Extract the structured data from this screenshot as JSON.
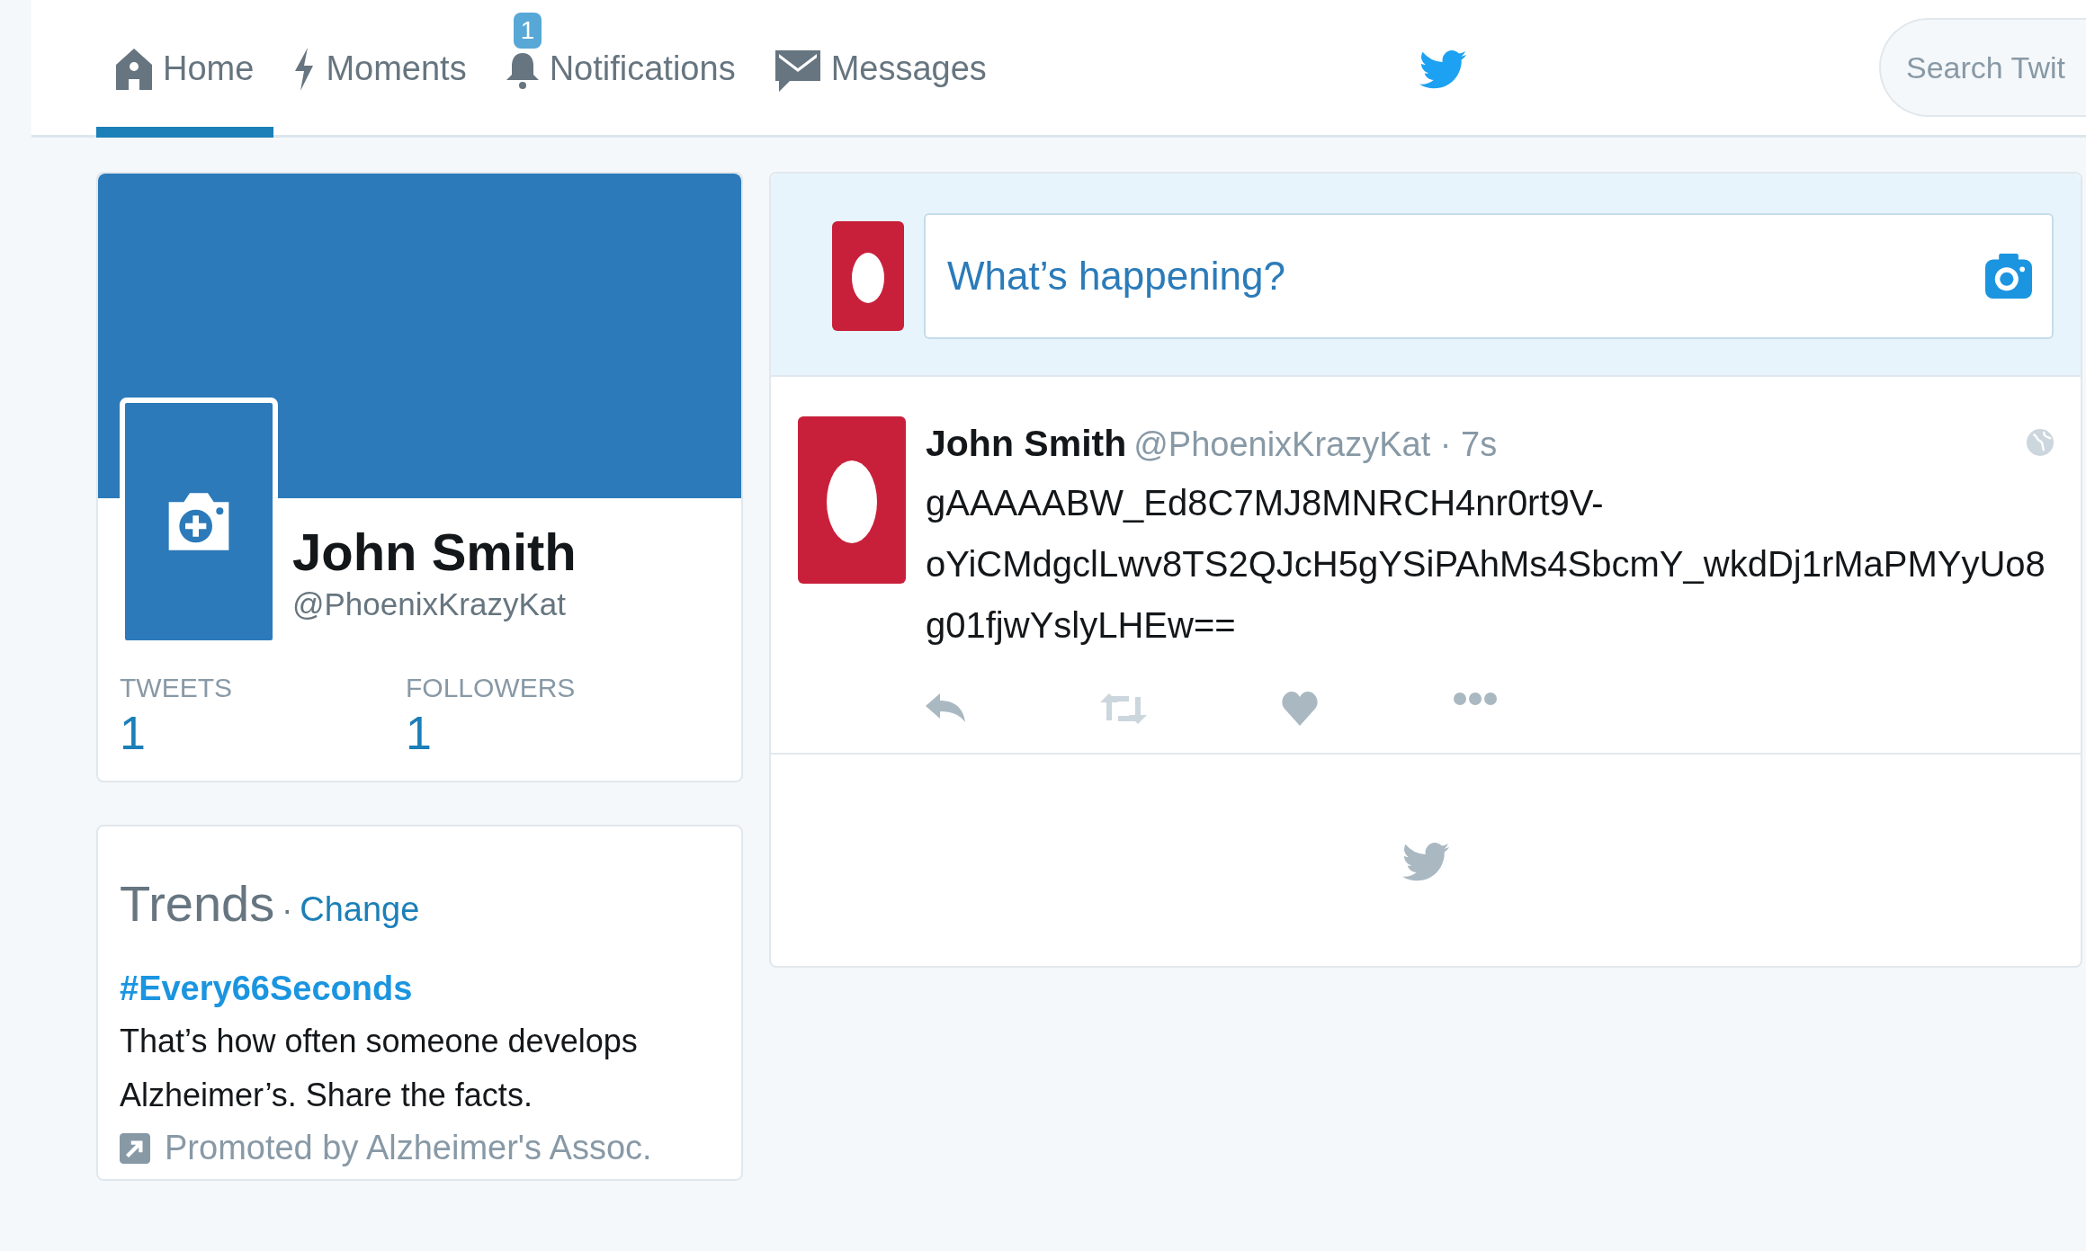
{
  "nav": {
    "tabs": [
      {
        "label": "Home",
        "selected": true
      },
      {
        "label": "Moments",
        "selected": false
      },
      {
        "label": "Notifications",
        "selected": false,
        "badge": "1"
      },
      {
        "label": "Messages",
        "selected": false
      }
    ],
    "search": {
      "placeholder": "Search Twit"
    }
  },
  "profile": {
    "name": "John Smith",
    "handle": "@PhoenixKrazyKat",
    "stats": [
      {
        "label": "TWEETS",
        "value": "1"
      },
      {
        "label": "FOLLOWERS",
        "value": "1"
      }
    ]
  },
  "trends": {
    "title": "Trends",
    "separator": "·",
    "change": "Change",
    "items": [
      {
        "tag": "#Every66Seconds",
        "description": "That’s how often someone develops Alzheimer’s. Share the facts.",
        "promoted": "Promoted by Alzheimer's Assoc."
      }
    ]
  },
  "composer": {
    "placeholder": "What’s happening?"
  },
  "tweets": [
    {
      "name": "John Smith",
      "handle": "@PhoenixKrazyKat",
      "separator": "·",
      "time": "7s",
      "text": "gAAAAABW_Ed8C7MJ8MNRCH4nr0rt9V-oYiCMdgclLwv8TS2QJcH5gYSiPAhMs4SbcmY_wkdDj1rMaPMYyUo8g01fjwYslyLHEw=="
    }
  ]
}
